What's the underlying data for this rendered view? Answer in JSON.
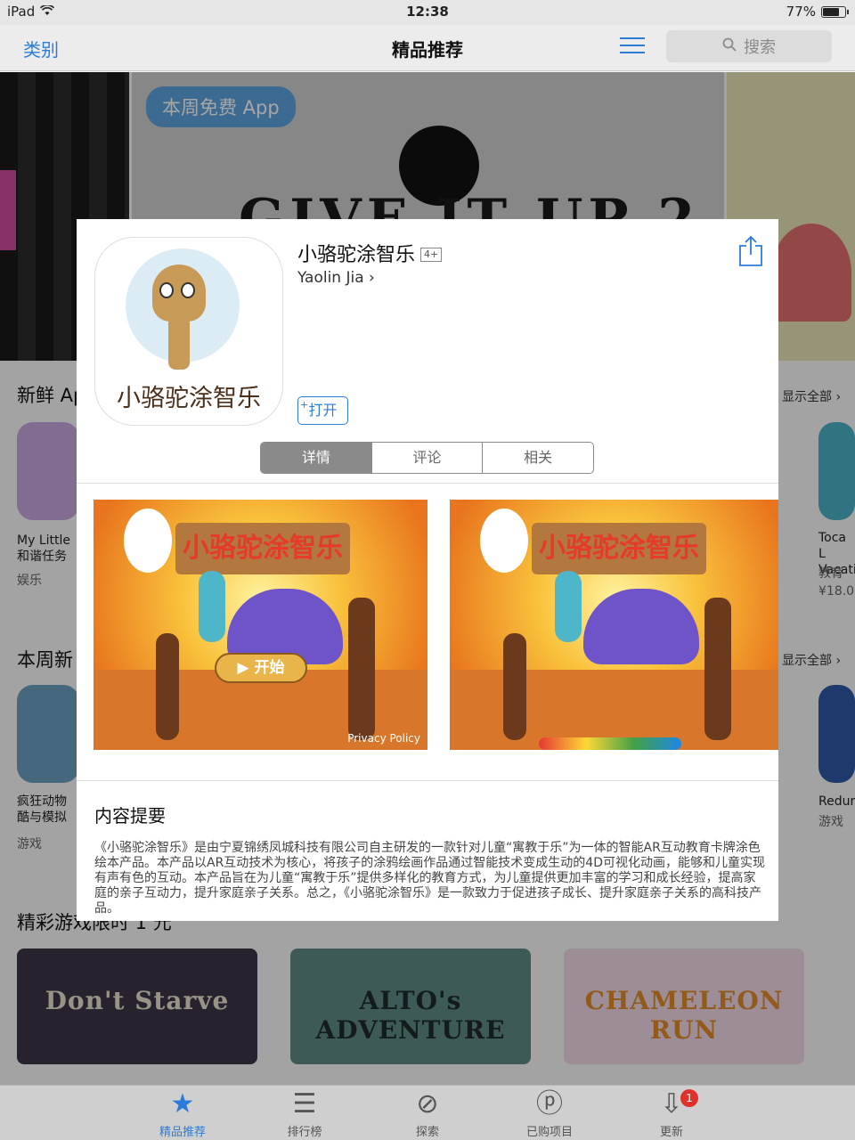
{
  "status_bar": {
    "device": "iPad",
    "time": "12:38",
    "battery": "77%",
    "battery_level": 0.77
  },
  "nav": {
    "back": "类别",
    "title": "精品推荐",
    "search_placeholder": "搜索"
  },
  "banner": {
    "badge": "本周免费 App"
  },
  "background": {
    "section1": {
      "title": "新鲜 Ap",
      "show_all": "显示全部"
    },
    "section2": {
      "title": "本周新",
      "show_all": "显示全部"
    },
    "section3": {
      "title": "精彩游戏限时 1 元"
    },
    "apps_row1": [
      {
        "name": "My Little",
        "name2": "和谐任务",
        "category": "娱乐"
      },
      {
        "name": "Toca L",
        "name2": "Vacati",
        "category": "教育",
        "price": "¥18.0"
      }
    ],
    "apps_row2": [
      {
        "name": "疯狂动物",
        "name2": "酷与模拟",
        "category": "游戏"
      },
      {
        "name": "Redur",
        "category": "游戏"
      }
    ],
    "promos": [
      "Don't Starve",
      "ALTO's ADVENTURE",
      "CHAMELEON RUN"
    ]
  },
  "modal": {
    "app_name": "小骆驼涂智乐",
    "age_rating": "4+",
    "developer": "Yaolin Jia",
    "open_button": "打开",
    "icon_text": "小骆驼涂智乐",
    "tabs": [
      "详情",
      "评论",
      "相关"
    ],
    "active_tab": "详情",
    "screenshot": {
      "sign": "小骆驼涂智乐",
      "start": "开始",
      "privacy": "Privacy Policy"
    },
    "description_heading": "内容提要",
    "description": "《小骆驼涂智乐》是由宁夏锦绣凤城科技有限公司自主研发的一款针对儿童“寓教于乐”为一体的智能AR互动教育卡牌涂色绘本产品。本产品以AR互动技术为核心，将孩子的涂鸦绘画作品通过智能技术变成生动的4D可视化动画，能够和儿童实现有声有色的互动。本产品旨在为儿童“寓教于乐”提供多样化的教育方式，为儿童提供更加丰富的学习和成长经验，提高家庭的亲子互动力，提升家庭亲子关系。总之，《小骆驼涂智乐》是一款致力于促进孩子成长、提升家庭亲子关系的高科技产品。"
  },
  "tabbar": [
    {
      "label": "精品推荐",
      "icon": "star-icon",
      "active": true
    },
    {
      "label": "排行榜",
      "icon": "list-icon"
    },
    {
      "label": "探索",
      "icon": "compass-icon"
    },
    {
      "label": "已购项目",
      "icon": "purchased-icon"
    },
    {
      "label": "更新",
      "icon": "download-icon",
      "badge": "1"
    }
  ],
  "colors": {
    "accent": "#2b7cd9",
    "badge": "#e0302c"
  }
}
